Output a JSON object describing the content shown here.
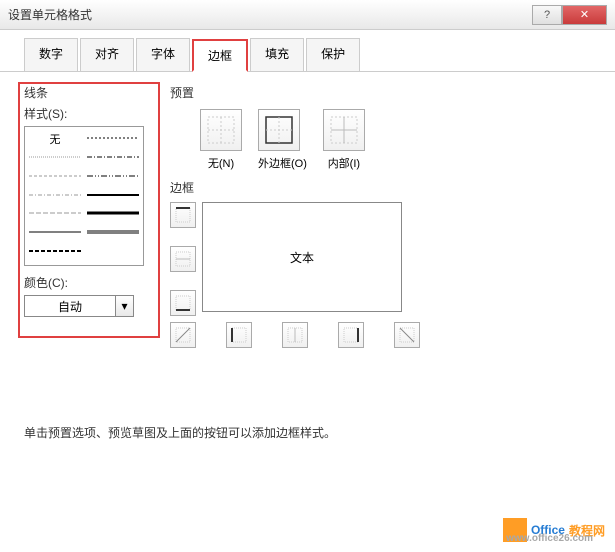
{
  "titlebar": {
    "title": "设置单元格格式"
  },
  "tabs": {
    "items": [
      {
        "label": "数字"
      },
      {
        "label": "对齐"
      },
      {
        "label": "字体"
      },
      {
        "label": "边框"
      },
      {
        "label": "填充"
      },
      {
        "label": "保护"
      }
    ],
    "active_index": 3
  },
  "line": {
    "section_label": "线条",
    "style_label": "样式(S):",
    "none_label": "无",
    "color_label": "颜色(C):",
    "color_value": "自动"
  },
  "preset": {
    "section_label": "预置",
    "items": [
      {
        "label": "无(N)"
      },
      {
        "label": "外边框(O)"
      },
      {
        "label": "内部(I)"
      }
    ]
  },
  "border": {
    "section_label": "边框",
    "preview_text": "文本"
  },
  "help_text": "单击预置选项、预览草图及上面的按钮可以添加边框样式。",
  "watermark": {
    "text1": "Office",
    "text2": "教程网",
    "url": "www.office26.com"
  }
}
